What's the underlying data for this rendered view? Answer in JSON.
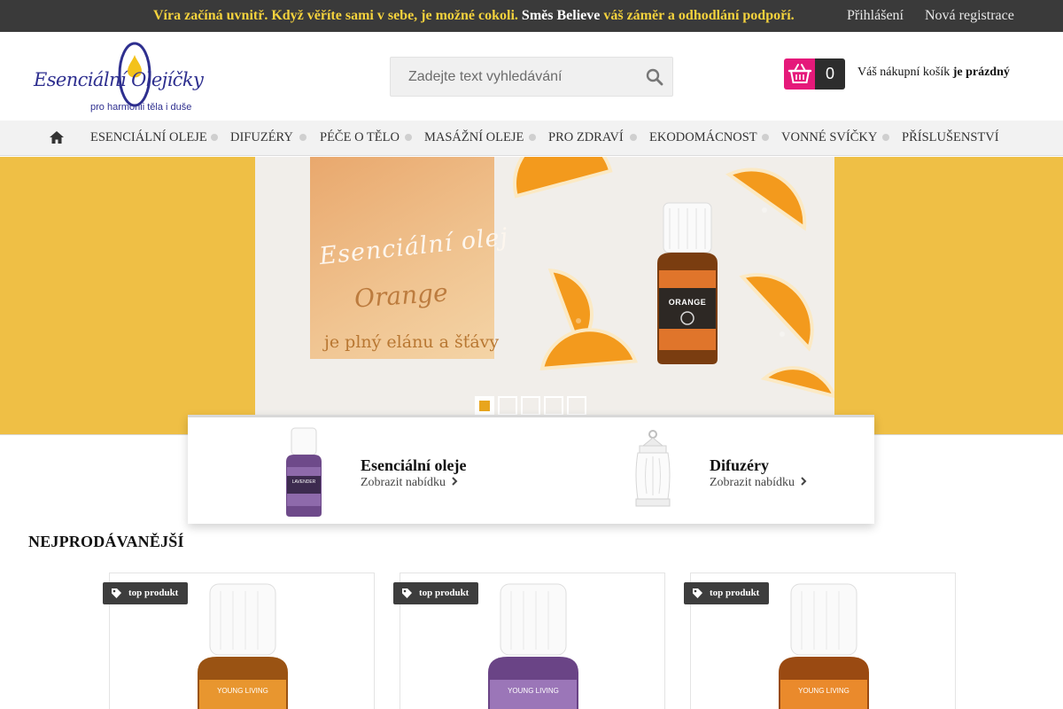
{
  "topbar": {
    "promo_part1": "Víra začíná uvnitř. Když věříte sami v sebe, je možné cokoli.",
    "promo_part2": "Směs Believe",
    "promo_part3": "váš záměr a odhodlání podpoří.",
    "login": "Přihlášení",
    "register": "Nová registrace"
  },
  "logo": {
    "name": "Esenciální Olejíčky",
    "tagline": "pro harmonii těla i duše"
  },
  "search": {
    "placeholder": "Zadejte text vyhledávání"
  },
  "cart": {
    "count": "0",
    "label": "Váš nákupní košík",
    "status": "je prázdný"
  },
  "nav": {
    "items": [
      "ESENCIÁLNÍ OLEJE",
      "DIFUZÉRY",
      "PÉČE O TĚLO",
      "MASÁŽNÍ OLEJE",
      "PRO ZDRAVÍ",
      "EKODOMÁCNOST",
      "VONNÉ SVÍČKY",
      "PŘÍSLUŠENSTVÍ"
    ]
  },
  "banner": {
    "line1": "Esenciální olej",
    "line2": "Orange",
    "line3": "je plný elánu a šťávy",
    "bottle_label": "ORANGE",
    "slides": 5,
    "active_slide": 1
  },
  "categories": [
    {
      "title": "Esenciální oleje",
      "link": "Zobrazit nabídku",
      "bottle_label": "LAVENDER"
    },
    {
      "title": "Difuzéry",
      "link": "Zobrazit nabídku"
    }
  ],
  "bestsellers": {
    "title": "NEJPRODÁVANĚJŠÍ",
    "products": [
      {
        "badge": "top produkt",
        "color": "#e8962f"
      },
      {
        "badge": "top produkt",
        "color": "#9b76b8"
      },
      {
        "badge": "top produkt",
        "color": "#ea8a2c"
      }
    ]
  },
  "colors": {
    "topbar": "#3a3a3a",
    "promo_accent": "#f4d23d",
    "cart_accent": "#e5197a",
    "banner_bg": "#efbf45",
    "slider_active": "#e8a51d"
  }
}
